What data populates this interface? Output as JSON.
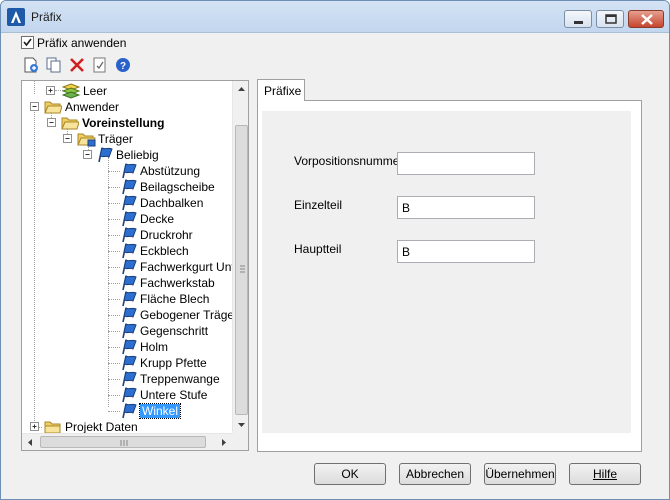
{
  "window": {
    "title": "Präfix"
  },
  "options": {
    "apply_prefix_label": "Präfix anwenden",
    "apply_prefix_checked": true
  },
  "toolbar": {
    "icons": [
      "add-icon",
      "copy-icon",
      "delete-icon",
      "properties-icon",
      "help-icon"
    ]
  },
  "tree": {
    "top_items": {
      "leer": "Leer",
      "anwender": "Anwender",
      "voreinstellung": "Voreinstellung",
      "traeger": "Träger",
      "beliebig": "Beliebig",
      "projekt": "Projekt Daten"
    },
    "leaves": [
      "Abstützung",
      "Beilagscheibe",
      "Dachbalken",
      "Decke",
      "Druckrohr",
      "Eckblech",
      "Fachwerkgurt Unte",
      "Fachwerkstab",
      "Fläche Blech",
      "Gebogener Träger",
      "Gegenschritt",
      "Holm",
      "Krupp Pfette",
      "Treppenwange",
      "Untere Stufe",
      "Winkel"
    ],
    "selected": "Winkel"
  },
  "tab": {
    "label": "Präfixe"
  },
  "form": {
    "vorposition": {
      "label": "Vorpositionsnummer",
      "value": ""
    },
    "einzelteil": {
      "label": "Einzelteil",
      "value": "B"
    },
    "hauptteil": {
      "label": "Hauptteil",
      "value": "B"
    }
  },
  "buttons": {
    "ok": "OK",
    "cancel": "Abbrechen",
    "apply": "Übernehmen",
    "help": "Hilfe"
  }
}
